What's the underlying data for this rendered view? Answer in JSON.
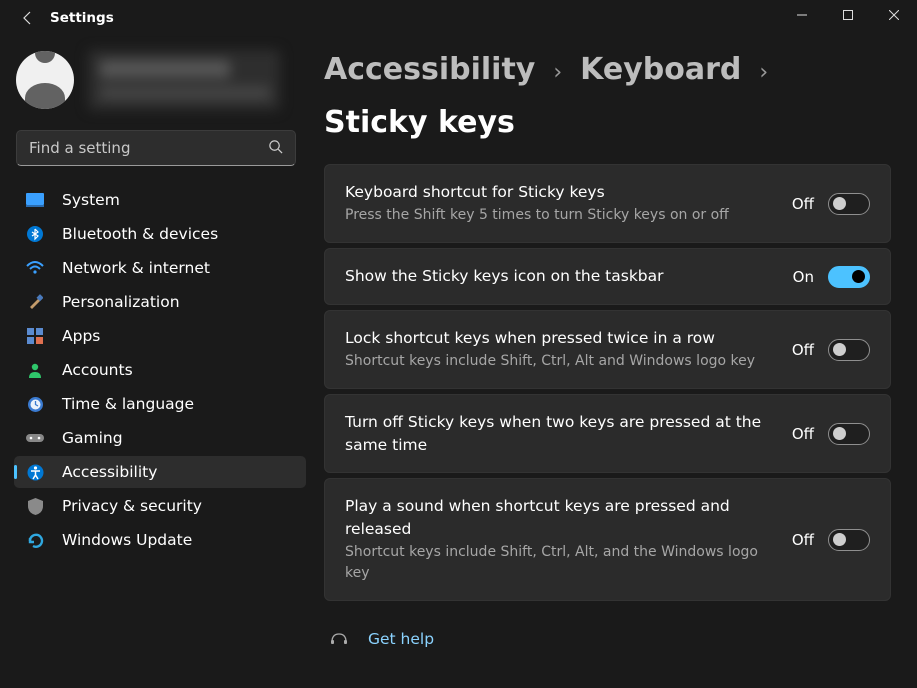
{
  "app": {
    "title": "Settings"
  },
  "search": {
    "placeholder": "Find a setting"
  },
  "nav": {
    "items": [
      {
        "label": "System"
      },
      {
        "label": "Bluetooth & devices"
      },
      {
        "label": "Network & internet"
      },
      {
        "label": "Personalization"
      },
      {
        "label": "Apps"
      },
      {
        "label": "Accounts"
      },
      {
        "label": "Time & language"
      },
      {
        "label": "Gaming"
      },
      {
        "label": "Accessibility"
      },
      {
        "label": "Privacy & security"
      },
      {
        "label": "Windows Update"
      }
    ],
    "selected_index": 8
  },
  "breadcrumb": {
    "part1": "Accessibility",
    "part2": "Keyboard",
    "current": "Sticky keys"
  },
  "settings": [
    {
      "title": "Keyboard shortcut for Sticky keys",
      "desc": "Press the Shift key 5 times to turn Sticky keys on or off",
      "state_label": "Off",
      "on": false
    },
    {
      "title": "Show the Sticky keys icon on the taskbar",
      "desc": "",
      "state_label": "On",
      "on": true
    },
    {
      "title": "Lock shortcut keys when pressed twice in a row",
      "desc": "Shortcut keys include Shift, Ctrl, Alt and Windows logo key",
      "state_label": "Off",
      "on": false
    },
    {
      "title": "Turn off Sticky keys when two keys are pressed at the same time",
      "desc": "",
      "state_label": "Off",
      "on": false
    },
    {
      "title": "Play a sound when shortcut keys are pressed and released",
      "desc": "Shortcut keys include Shift, Ctrl, Alt, and the Windows logo key",
      "state_label": "Off",
      "on": false
    }
  ],
  "help": {
    "label": "Get help"
  }
}
